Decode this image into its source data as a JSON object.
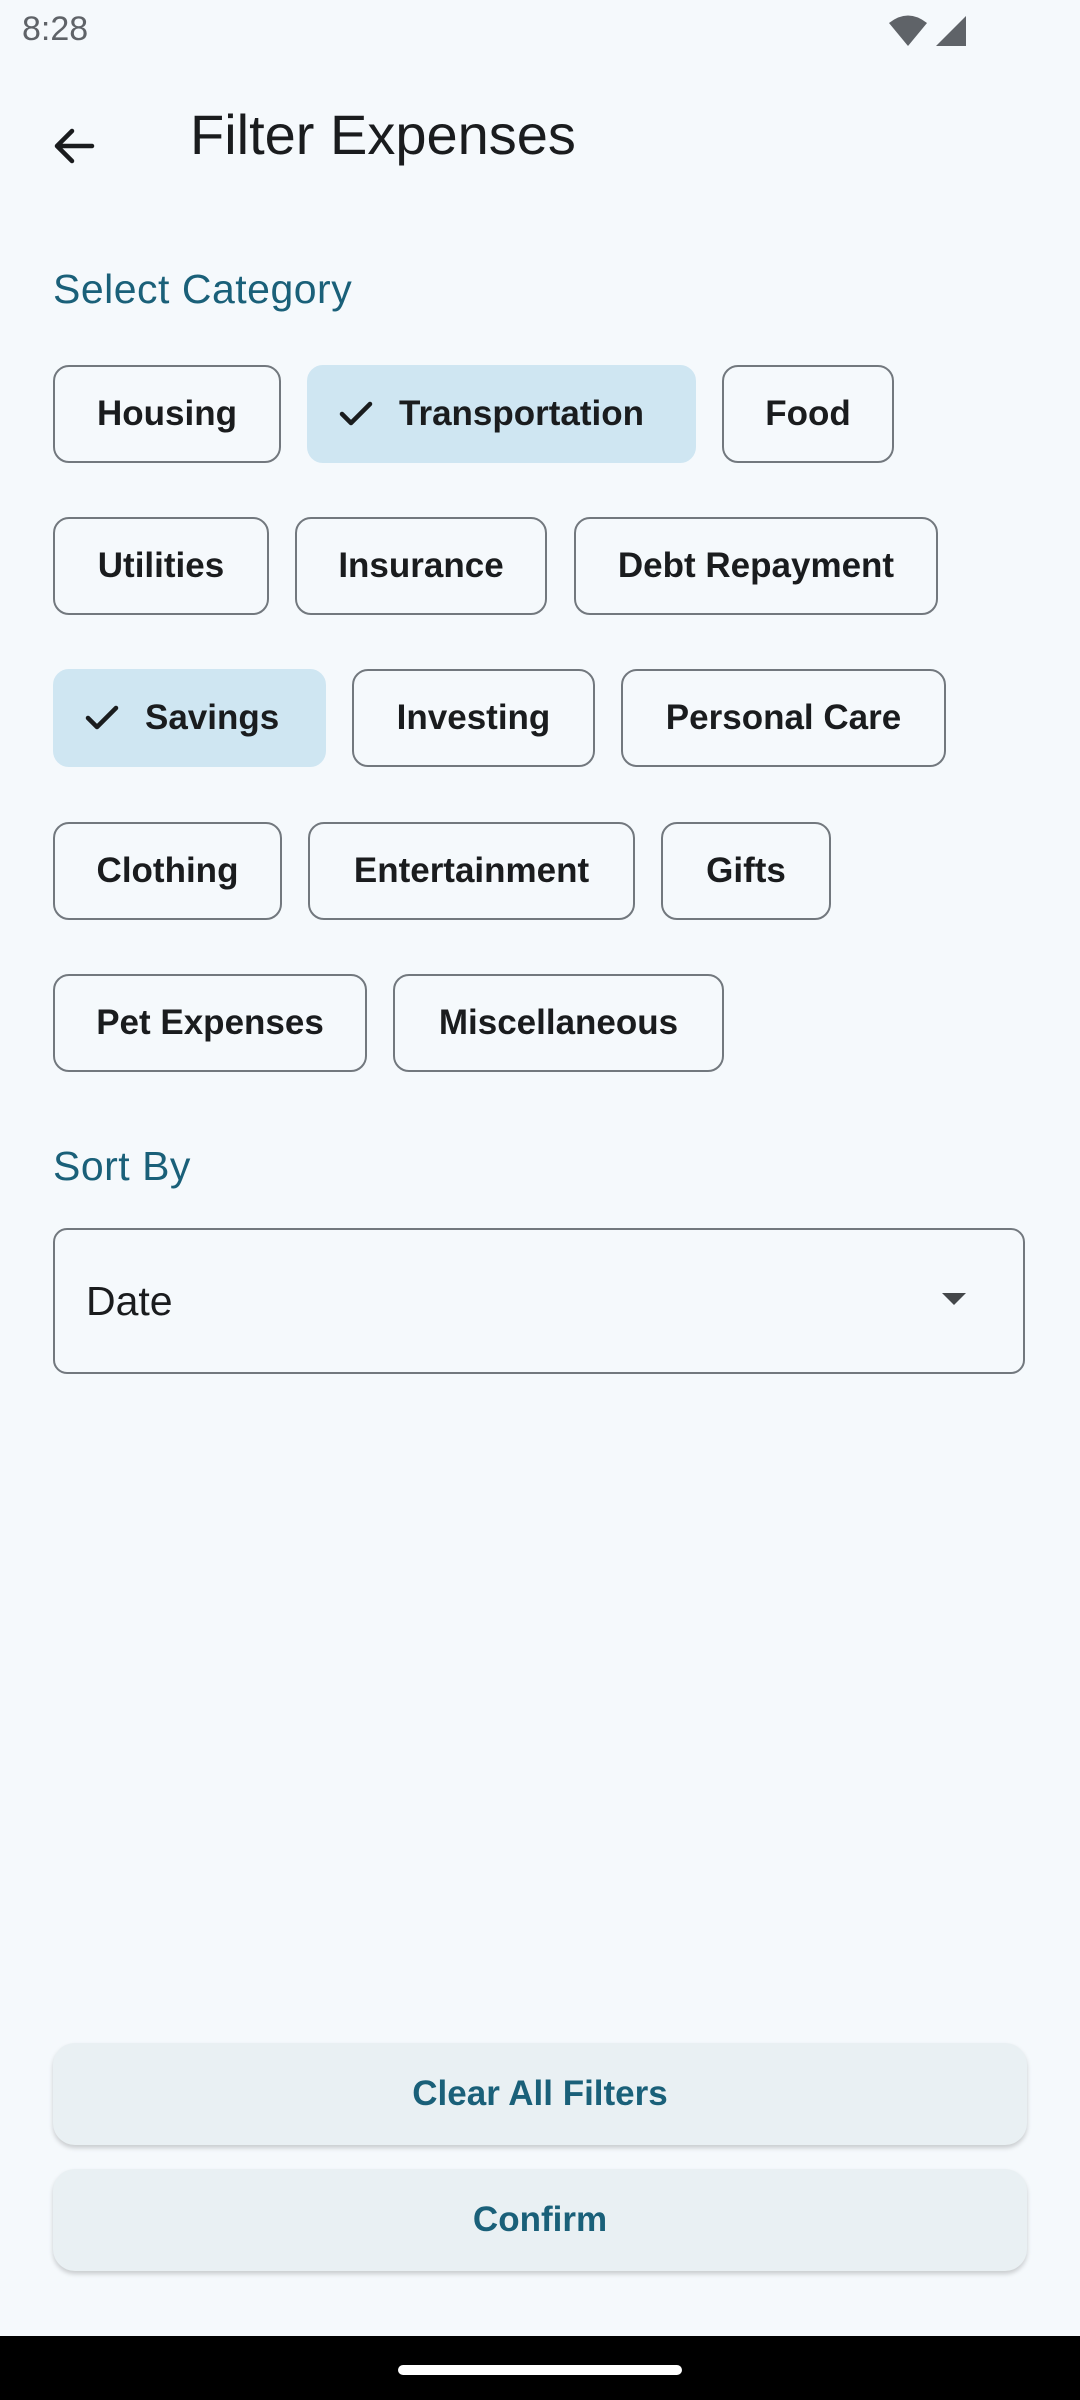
{
  "status_bar": {
    "time": "8:28",
    "icons": [
      "wifi-icon",
      "cell-signal-icon"
    ]
  },
  "app_bar": {
    "title": "Filter Expenses",
    "back_icon": "arrow-back-icon"
  },
  "category_section": {
    "label": "Select Category",
    "rows": [
      [
        {
          "label": "Housing",
          "selected": false
        },
        {
          "label": "Transportation",
          "selected": true
        },
        {
          "label": "Food",
          "selected": false
        }
      ],
      [
        {
          "label": "Utilities",
          "selected": false
        },
        {
          "label": "Insurance",
          "selected": false
        },
        {
          "label": "Debt Repayment",
          "selected": false
        }
      ],
      [
        {
          "label": "Savings",
          "selected": true
        },
        {
          "label": "Investing",
          "selected": false
        },
        {
          "label": "Personal Care",
          "selected": false
        }
      ],
      [
        {
          "label": "Clothing",
          "selected": false
        },
        {
          "label": "Entertainment",
          "selected": false
        },
        {
          "label": "Gifts",
          "selected": false
        }
      ],
      [
        {
          "label": "Pet Expenses",
          "selected": false
        },
        {
          "label": "Miscellaneous",
          "selected": false
        }
      ]
    ]
  },
  "sort_section": {
    "label": "Sort By",
    "selected_value": "Date"
  },
  "actions": {
    "clear_label": "Clear All Filters",
    "confirm_label": "Confirm"
  },
  "colors": {
    "background": "#f5f9fc",
    "accent": "#1a6079",
    "chip_selected": "#cfe6f2",
    "chip_border": "#72787e",
    "button_bg": "#e9f0f3"
  }
}
